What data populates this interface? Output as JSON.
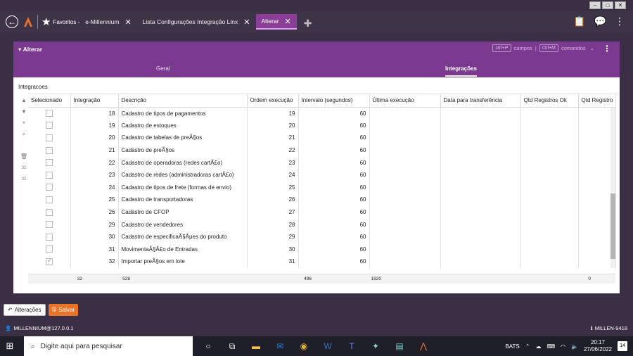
{
  "app": {
    "favorites_label": "Favoritos -",
    "tabs": [
      {
        "label": "e-Millennium"
      },
      {
        "label": "Lista Configurações Integração Linx"
      },
      {
        "label": "Alterar"
      }
    ]
  },
  "panel": {
    "title": "Alterar",
    "shortcut_fields_key": "ctrl+P",
    "shortcut_fields_label": "campos",
    "shortcut_divider": "|",
    "shortcut_commands_key": "ctrl+M",
    "shortcut_commands_label": "comandos",
    "subtabs": [
      {
        "label": "Geral"
      },
      {
        "label": "Integrações"
      }
    ],
    "section_title": "Integracoes"
  },
  "grid": {
    "columns": [
      "Selecionado",
      "Integração",
      "Descrição",
      "Ordem execução",
      "Intervalo (segundos)",
      "Última execução",
      "Data para transferência",
      "Qtd Registros Ok",
      "Qtd Registro"
    ],
    "rows": [
      {
        "selected": false,
        "integracao": "18",
        "descricao": "Cadastro de tipos de pagamentos",
        "ordem": "19",
        "intervalo": "60"
      },
      {
        "selected": false,
        "integracao": "19",
        "descricao": "Cadastro de estoques",
        "ordem": "20",
        "intervalo": "60"
      },
      {
        "selected": false,
        "integracao": "20",
        "descricao": "Cadastro de tabelas de preÃ§os",
        "ordem": "21",
        "intervalo": "60"
      },
      {
        "selected": false,
        "integracao": "21",
        "descricao": "Cadastro de preÃ§os",
        "ordem": "22",
        "intervalo": "60"
      },
      {
        "selected": false,
        "integracao": "22",
        "descricao": "Cadastro de operadoras (redes cartÃ£o)",
        "ordem": "23",
        "intervalo": "60"
      },
      {
        "selected": false,
        "integracao": "23",
        "descricao": "Cadastro de redes (administradoras cartÃ£o)",
        "ordem": "24",
        "intervalo": "60"
      },
      {
        "selected": false,
        "integracao": "24",
        "descricao": "Cadastro de tipos de frete (formas de envio)",
        "ordem": "25",
        "intervalo": "60"
      },
      {
        "selected": false,
        "integracao": "25",
        "descricao": "Cadastro de transportadoras",
        "ordem": "26",
        "intervalo": "60"
      },
      {
        "selected": false,
        "integracao": "26",
        "descricao": "Cadastro de CFOP",
        "ordem": "27",
        "intervalo": "60"
      },
      {
        "selected": false,
        "integracao": "29",
        "descricao": "Cadastro de vendedores",
        "ordem": "28",
        "intervalo": "60"
      },
      {
        "selected": false,
        "integracao": "30",
        "descricao": "Cadastro de especificaÃ§Ãµes do produto",
        "ordem": "29",
        "intervalo": "60"
      },
      {
        "selected": false,
        "integracao": "31",
        "descricao": "MovimentaÃ§Ã£o de Entradas",
        "ordem": "30",
        "intervalo": "60"
      },
      {
        "selected": true,
        "integracao": "32",
        "descricao": "Importar preÃ§os em lote",
        "ordem": "31",
        "intervalo": "60"
      }
    ],
    "totals": {
      "selecionado": "32",
      "integracao": "528",
      "ordem": "496",
      "intervalo": "1920",
      "qtd_ok": "0"
    },
    "side_counts": [
      "32",
      "32"
    ],
    "scroll_fraction": 0.9
  },
  "footer": {
    "changes_label": "Alterações",
    "save_label": "Salvar",
    "user": "MILLENNIUM@127.0.0.1",
    "machine": "MILLEN-9418"
  },
  "taskbar": {
    "search_placeholder": "Digite aqui para pesquisar",
    "tray_label": "BATS",
    "time": "20:17",
    "date": "27/06/2022",
    "notifications": "14"
  },
  "colors": {
    "accent": "#7b3a8f",
    "save": "#e8742a",
    "active_tab": "#8a3e97"
  }
}
